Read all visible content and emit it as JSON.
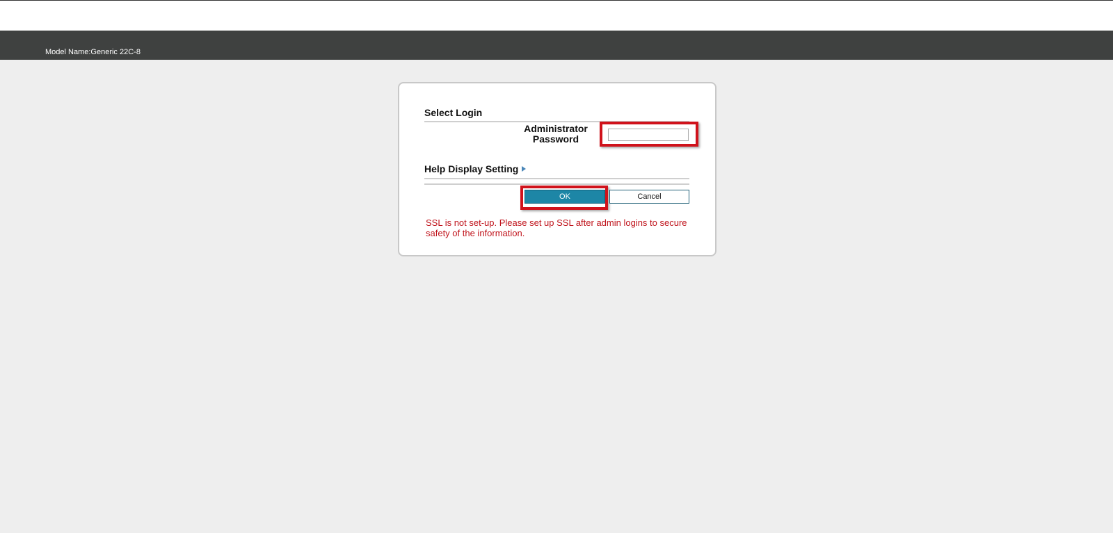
{
  "header": {
    "model_name": "Model Name:Generic 22C-8"
  },
  "login": {
    "title": "Select Login",
    "password_label_line1": "Administrator",
    "password_label_line2": "Password",
    "password_value": "",
    "help_display_setting": "Help Display Setting",
    "ok_label": "OK",
    "cancel_label": "Cancel",
    "ssl_warning": "SSL is not set-up. Please set up SSL after admin logins to secure safety of the information."
  },
  "colors": {
    "header_bg": "#3f4140",
    "page_bg": "#eeeeee",
    "ok_button_bg": "#1d86a6",
    "highlight": "#d0121b",
    "warning_text": "#c0141c"
  },
  "icons": {
    "help_arrow": "triangle-right-icon"
  }
}
